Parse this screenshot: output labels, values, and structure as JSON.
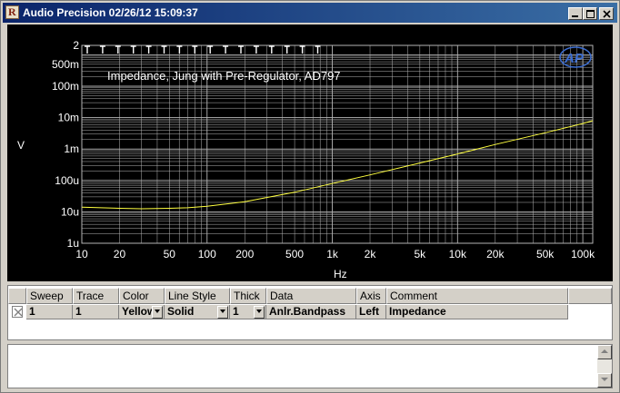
{
  "window": {
    "title": "Audio Precision  02/26/12 15:09:37"
  },
  "chart_data": {
    "type": "line",
    "title": "Impedance, Jung with Pre-Regulator, AD797",
    "xlabel": "Hz",
    "ylabel": "V",
    "xscale": "log",
    "yscale": "log",
    "xlim": [
      10,
      120000
    ],
    "ylim": [
      1e-06,
      2
    ],
    "x_ticks": [
      10,
      20,
      50,
      100,
      200,
      500,
      1000,
      2000,
      5000,
      10000,
      20000,
      50000,
      100000
    ],
    "x_tick_labels": [
      "10",
      "20",
      "50",
      "100",
      "200",
      "500",
      "1k",
      "2k",
      "5k",
      "10k",
      "20k",
      "50k",
      "100k"
    ],
    "y_ticks": [
      1e-06,
      1e-05,
      0.0001,
      0.001,
      0.01,
      0.1,
      0.5,
      2
    ],
    "y_tick_labels": [
      "1u",
      "10u",
      "100u",
      "1m",
      "10m",
      "100m",
      "500m",
      "2"
    ],
    "grid": true,
    "logo_text": "AP",
    "colors": {
      "background": "#000000",
      "grid": "#b4b4b4",
      "text": "#ffffff",
      "trace": "#ffff40",
      "logo": "#3c6ed2"
    },
    "series": [
      {
        "x": [
          10,
          20,
          30,
          50,
          70,
          100,
          200,
          500,
          1000,
          2000,
          5000,
          10000,
          20000,
          50000,
          100000,
          120000
        ],
        "values": [
          1.4e-05,
          1.3e-05,
          1.25e-05,
          1.3e-05,
          1.35e-05,
          1.5e-05,
          2.1e-05,
          4.2e-05,
          8e-05,
          0.00015,
          0.00036,
          0.0007,
          0.0014,
          0.0033,
          0.0065,
          0.008
        ]
      }
    ]
  },
  "table": {
    "columns": [
      "Sweep",
      "Trace",
      "Color",
      "Line Style",
      "Thick",
      "Data",
      "Axis",
      "Comment"
    ],
    "row": {
      "sweep": "1",
      "trace": "1",
      "color": "Yellow",
      "line_style": "Solid",
      "thick": "1",
      "data": "Anlr.Bandpass",
      "axis": "Left",
      "comment": "Impedance"
    }
  }
}
